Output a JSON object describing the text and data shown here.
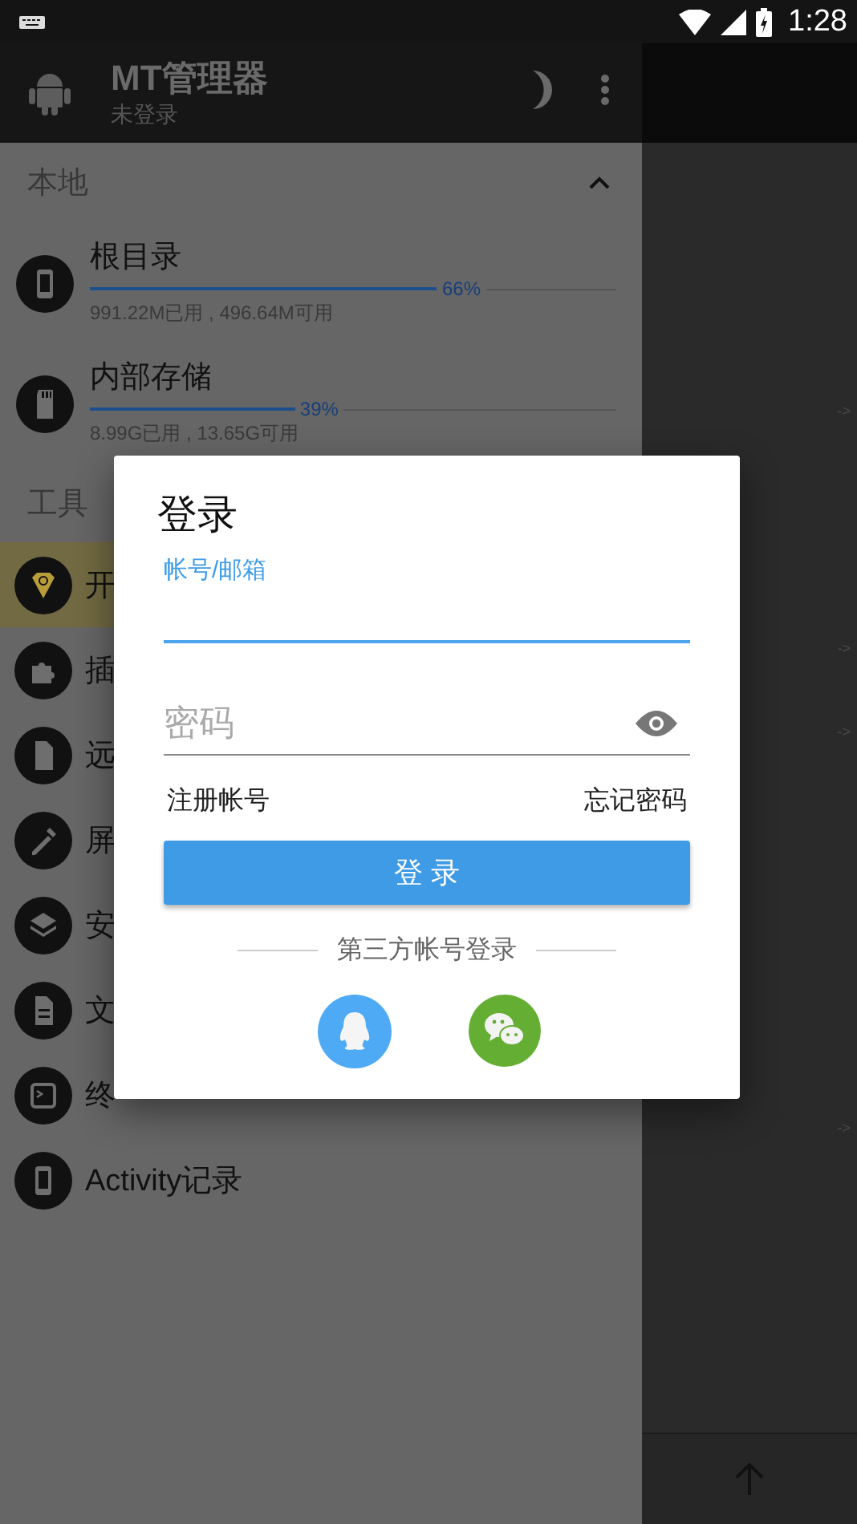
{
  "status_bar": {
    "time": "1:28"
  },
  "app_bar": {
    "title": "MT管理器",
    "subtitle": "未登录"
  },
  "drawer": {
    "local": {
      "title": "本地",
      "expanded": true,
      "items": [
        {
          "label": "根目录",
          "level": 0.66,
          "percent": "66%",
          "usage": "991.22M已用 , 496.64M可用"
        },
        {
          "label": "内部存储",
          "level": 0.39,
          "percent": "39%",
          "usage": "8.99G已用 , 13.65G可用"
        }
      ]
    },
    "tools": {
      "title": "工具",
      "items": [
        {
          "label": "开",
          "selected": true
        },
        {
          "label": "插",
          "selected": false
        },
        {
          "label": "远",
          "selected": false
        },
        {
          "label": "屏",
          "selected": false
        },
        {
          "label": "安",
          "selected": false
        },
        {
          "label": "文",
          "selected": false
        },
        {
          "label": "终",
          "selected": false
        },
        {
          "label": "Activity记录",
          "selected": false
        }
      ]
    }
  },
  "side_panel": {
    "markers": [
      "->",
      "->",
      "->",
      "->"
    ]
  },
  "login_dialog": {
    "title": "登录",
    "account_field": {
      "label": "帐号/邮箱",
      "focused": true
    },
    "password_field": {
      "placeholder": "密码"
    },
    "register_link": "注册帐号",
    "forgot_link": "忘记密码",
    "login_button": "登 录",
    "third_party_label": "第三方帐号登录",
    "providers": [
      {
        "kind": "qq",
        "color": "#4eaaf4"
      },
      {
        "kind": "wechat",
        "color": "#65ae34"
      }
    ]
  }
}
